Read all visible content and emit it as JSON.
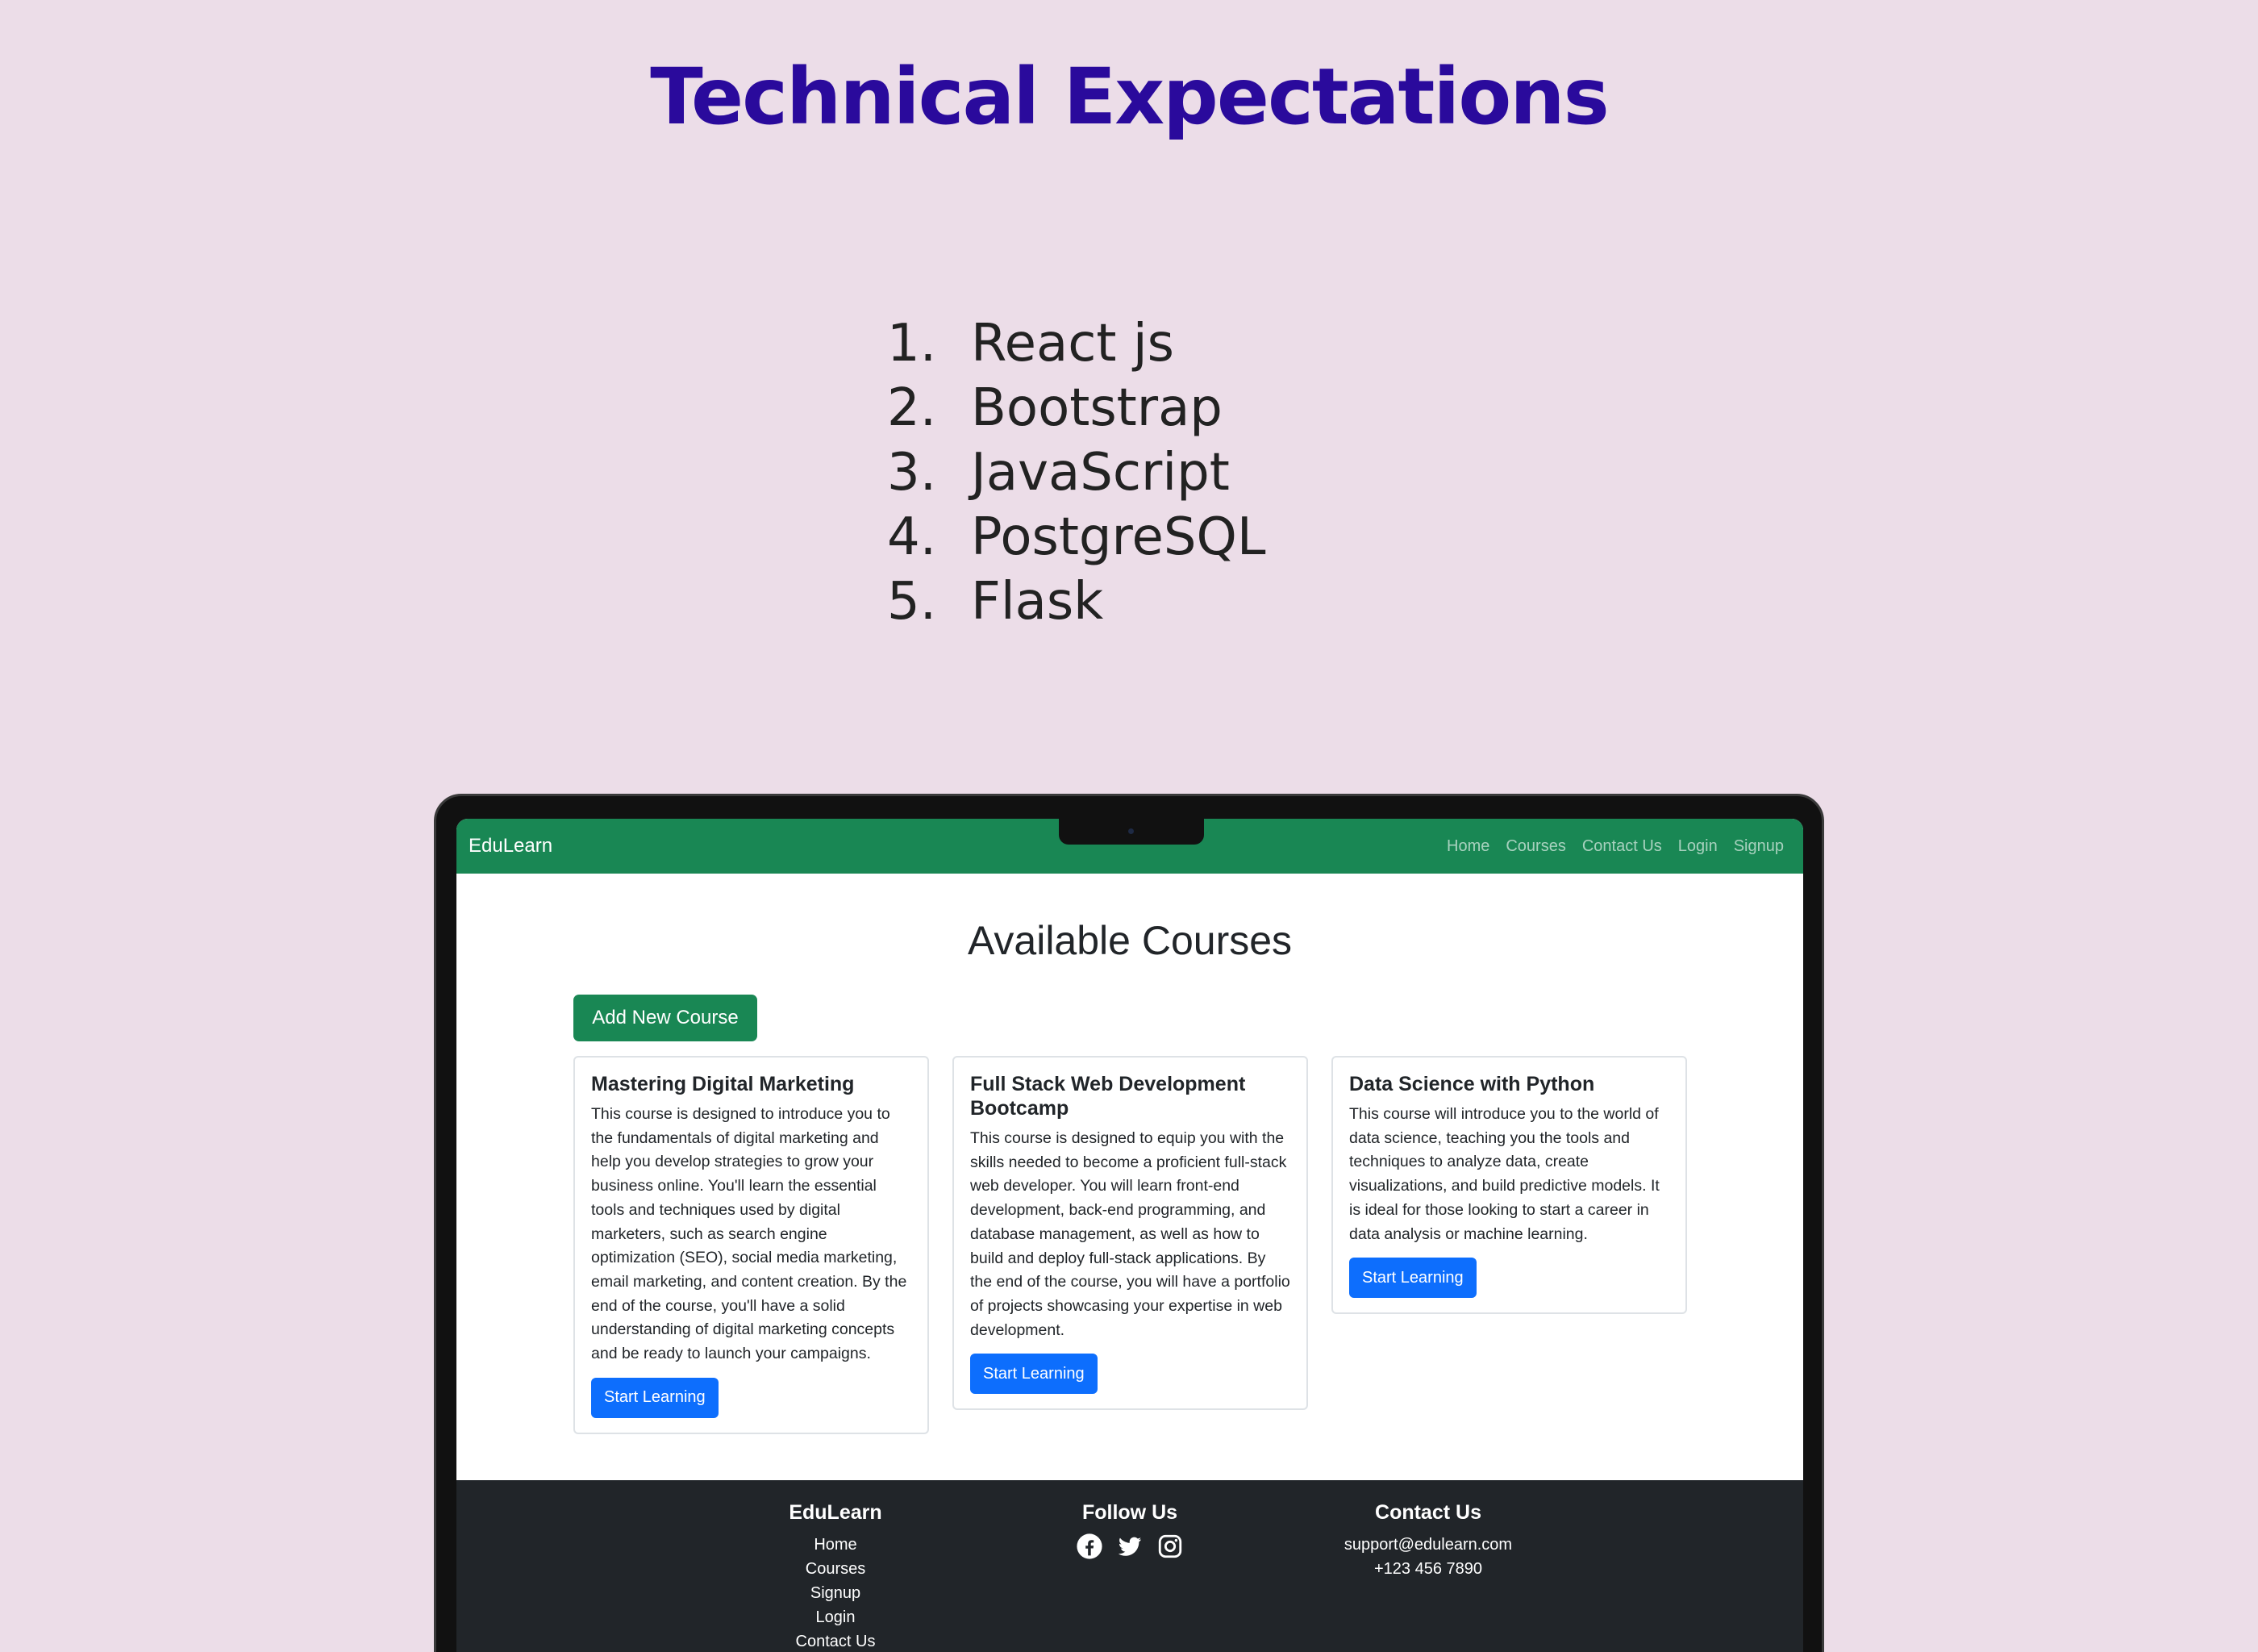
{
  "slide": {
    "title": "Technical Expectations",
    "items": [
      {
        "num": "1.",
        "label": "React js"
      },
      {
        "num": "2.",
        "label": "Bootstrap"
      },
      {
        "num": "3.",
        "label": "JavaScript"
      },
      {
        "num": "4.",
        "label": "PostgreSQL"
      },
      {
        "num": "5.",
        "label": "Flask"
      }
    ]
  },
  "app": {
    "brand": "EduLearn",
    "nav": [
      "Home",
      "Courses",
      "Contact Us",
      "Login",
      "Signup"
    ],
    "heading": "Available Courses",
    "add_button": "Add New Course",
    "courses": [
      {
        "title": "Mastering Digital Marketing",
        "description": "This course is designed to introduce you to the fundamentals of digital marketing and help you develop strategies to grow your business online. You'll learn the essential tools and techniques used by digital marketers, such as search engine optimization (SEO), social media marketing, email marketing, and content creation. By the end of the course, you'll have a solid understanding of digital marketing concepts and be ready to launch your campaigns.",
        "button": "Start Learning"
      },
      {
        "title": "Full Stack Web Development Bootcamp",
        "description": "This course is designed to equip you with the skills needed to become a proficient full-stack web developer. You will learn front-end development, back-end programming, and database management, as well as how to build and deploy full-stack applications. By the end of the course, you will have a portfolio of projects showcasing your expertise in web development.",
        "button": "Start Learning"
      },
      {
        "title": "Data Science with Python",
        "description": "This course will introduce you to the world of data science, teaching you the tools and techniques to analyze data, create visualizations, and build predictive models. It is ideal for those looking to start a career in data analysis or machine learning.",
        "button": "Start Learning"
      }
    ],
    "footer": {
      "brand_col": {
        "title": "EduLearn",
        "links": [
          "Home",
          "Courses",
          "Signup",
          "Login",
          "Contact Us"
        ]
      },
      "follow_col": {
        "title": "Follow Us",
        "icons": [
          "facebook-icon",
          "twitter-icon",
          "instagram-icon"
        ]
      },
      "contact_col": {
        "title": "Contact Us",
        "email": "support@edulearn.com",
        "phone": "+123 456 7890"
      }
    }
  },
  "colors": {
    "background": "#ecdde8",
    "title": "#2a0a9c",
    "navbar": "#198754",
    "primary_button": "#0d6efd",
    "footer": "#212529"
  }
}
